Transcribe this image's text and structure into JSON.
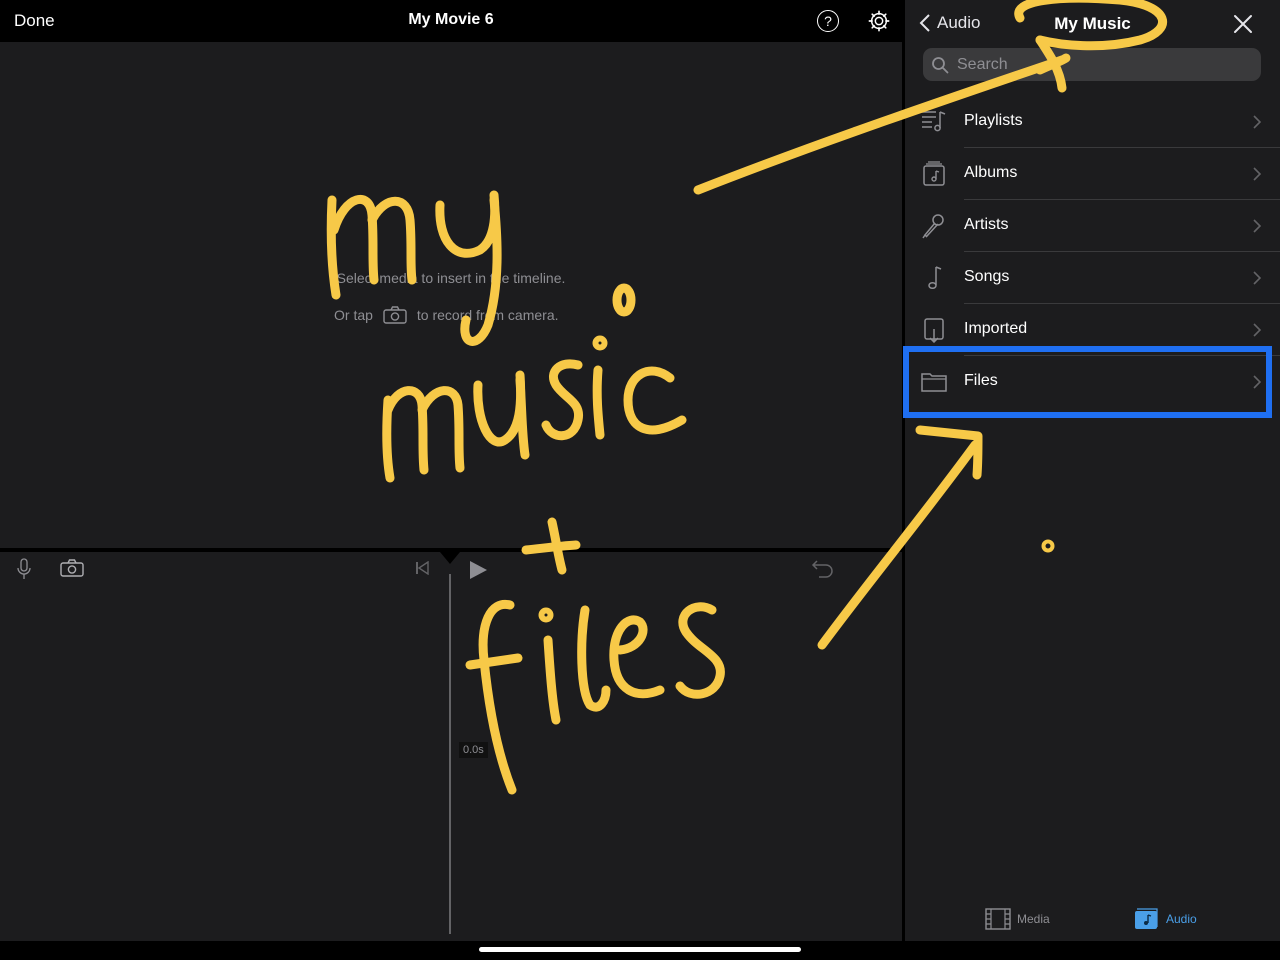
{
  "editor": {
    "done_label": "Done",
    "title": "My Movie 6",
    "help_label": "?",
    "viewer_hint_line1": "Select media to insert in the timeline.",
    "viewer_hint_or": "Or tap",
    "viewer_hint_line2_end": "to record from camera.",
    "time_badge": "0.0s"
  },
  "panel": {
    "back_label": "Audio",
    "title": "My Music",
    "search_placeholder": "Search",
    "items": [
      {
        "label": "Playlists",
        "icon": "playlist-icon"
      },
      {
        "label": "Albums",
        "icon": "album-icon"
      },
      {
        "label": "Artists",
        "icon": "microphone-icon"
      },
      {
        "label": "Songs",
        "icon": "music-note-icon"
      },
      {
        "label": "Imported",
        "icon": "imported-icon"
      },
      {
        "label": "Files",
        "icon": "folder-icon"
      }
    ],
    "tabs": [
      {
        "label": "Media",
        "icon": "film-icon",
        "active": false
      },
      {
        "label": "Audio",
        "icon": "music-icon",
        "active": true
      }
    ]
  },
  "colors": {
    "accent_blue": "#1f6ff2",
    "tab_active": "#4a9fe8",
    "annotation_yellow": "#f7c948"
  }
}
